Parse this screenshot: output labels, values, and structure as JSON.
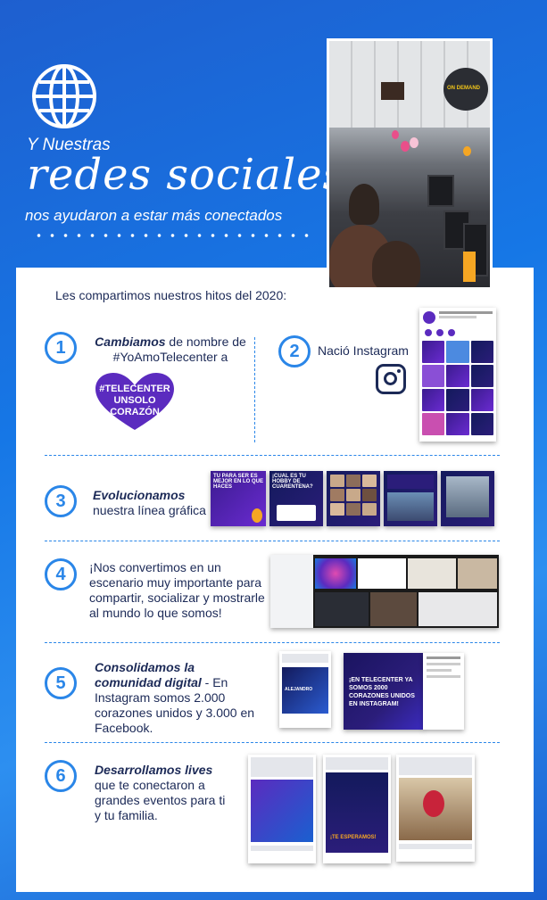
{
  "hero": {
    "kicker": "Y Nuestras",
    "title": "redes sociales",
    "subtitle": "nos ayudaron a estar más conectados",
    "photo_banner": "ON DEMAND"
  },
  "intro": "Les compartimos nuestros hitos del 2020:",
  "milestones": [
    {
      "number": "1",
      "lead": "Cambiamos",
      "rest": " de nombre de #YoAmoTelecenter a"
    },
    {
      "number": "2",
      "lead": "",
      "rest": "Nació Instagram"
    },
    {
      "number": "3",
      "lead": "Evolucionamos",
      "rest": "nuestra línea gráfica"
    },
    {
      "number": "4",
      "lead": "",
      "rest": "¡Nos convertimos en un escenario muy importante para compartir, socializar y mostrarle al mundo lo que somos!"
    },
    {
      "number": "5",
      "lead": "Consolidamos la comunidad digital",
      "rest": " - En Instagram somos 2.000 corazones unidos y 3.000 en Facebook."
    },
    {
      "number": "6",
      "lead": "Desarrollamos lives",
      "rest": " que te conectaron a grandes eventos para ti y tu familia."
    }
  ],
  "heart_badge": {
    "line1": "#TELECENTER",
    "line2": "UNSOLO",
    "line3": "CORAZÓN"
  },
  "graphic_posts": [
    {
      "text": "TU PARA SER ES MEJOR EN LO QUE HACES"
    },
    {
      "text": "¡CUAL ES TU HOBBY DE CUARENTENA?"
    },
    {
      "text": ""
    },
    {
      "text": ""
    },
    {
      "text": ""
    }
  ],
  "community_post": {
    "headline": "¡EN TELECENTER YA SOMOS 2000 CORAZONES UNIDOS EN INSTAGRAM!",
    "name": "ALEJANDRO"
  },
  "live_post": {
    "text": "¡TE ESPERAMOS!"
  },
  "colors": {
    "accent": "#2a86e8",
    "navy": "#1c2a57",
    "purple": "#5b2bbf"
  }
}
